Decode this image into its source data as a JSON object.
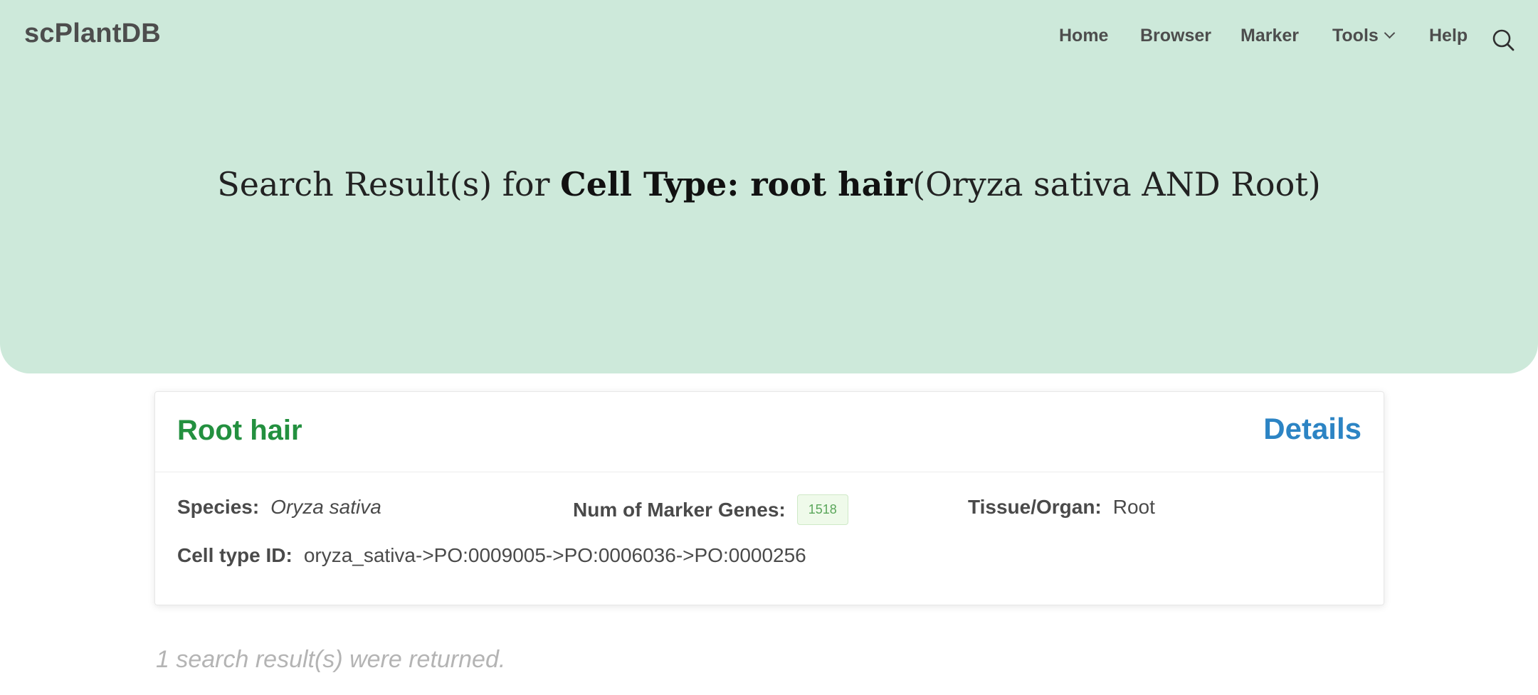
{
  "header": {
    "brand": "scPlantDB",
    "nav": {
      "home": "Home",
      "browser": "Browser",
      "marker": "Marker",
      "tools": "Tools",
      "help": "Help"
    }
  },
  "hero": {
    "prefix": "Search Result(s) for ",
    "query_bold": "Cell Type: root hair",
    "query_suffix": "(Oryza sativa AND Root)"
  },
  "result_card": {
    "title": "Root hair",
    "details_label": "Details",
    "species_label": "Species:",
    "species_value": "Oryza sativa",
    "markers_label": "Num of Marker Genes:",
    "markers_value": "1518",
    "tissue_label": "Tissue/Organ:",
    "tissue_value": "Root",
    "celltype_id_label": "Cell type ID:",
    "celltype_id_value": "oryza_sativa->PO:0009005->PO:0006036->PO:0000256"
  },
  "footer_note": "1 search result(s) were returned.",
  "colors": {
    "hero_bg": "#cde9da",
    "title_green": "#23903f",
    "link_blue": "#2c84c4"
  }
}
